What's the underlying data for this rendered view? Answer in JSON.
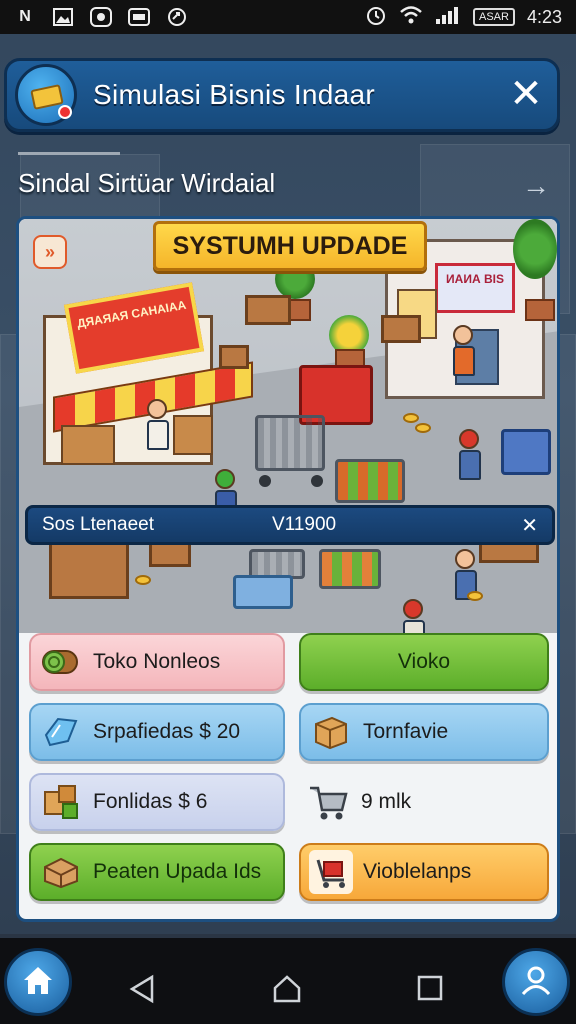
{
  "status_bar": {
    "left_icons": [
      "N",
      "gallery-icon",
      "record-icon",
      "message-icon",
      "sync-icon"
    ],
    "right": {
      "alarm": "alarm-icon",
      "wifi": "wifi-icon",
      "signal": "signal-icon",
      "battery": "ASAR",
      "time": "4:23"
    }
  },
  "header": {
    "title": "Simulasi Bisnis Indaar",
    "close_label": "✕"
  },
  "section": {
    "title": "Sindal Sirtüar Wirdaial",
    "arrow": "→"
  },
  "scene": {
    "banner": "SYSTUMH UPDADE",
    "corner_badge": "»",
    "left_sign": "ДЯАЯАЯ\nCAHAIAA",
    "right_sign": "ИАИА\nBIS",
    "info": {
      "label": "Sos Ltenaeet",
      "value": "V11900",
      "close": "✕"
    }
  },
  "buttons": [
    {
      "label": "Toko Nonleos",
      "icon": "log-icon"
    },
    {
      "label": "Vioko"
    },
    {
      "label": "Srpafiedas $ 20",
      "icon": "gem-icon"
    },
    {
      "label": "Tornfavie",
      "icon": "box-icon"
    },
    {
      "label": "Fonlidas $ 6",
      "icon": "boxes-icon"
    },
    {
      "label": "9 mlk",
      "icon": "cart-icon"
    },
    {
      "label": "Peaten Upada Ids",
      "icon": "crate-icon"
    },
    {
      "label": "Vioblelanps",
      "icon": "trolley-icon"
    }
  ],
  "colors": {
    "header_bg": "#1f5e9a",
    "banner_yellow": "#ffd84a",
    "primary_green": "#5cae2a",
    "accent_orange": "#f7a83a"
  },
  "navbar": {
    "home": "home-icon",
    "back": "back-icon",
    "home_sys": "home-outline-icon",
    "recents": "recents-icon",
    "profile": "profile-icon"
  }
}
